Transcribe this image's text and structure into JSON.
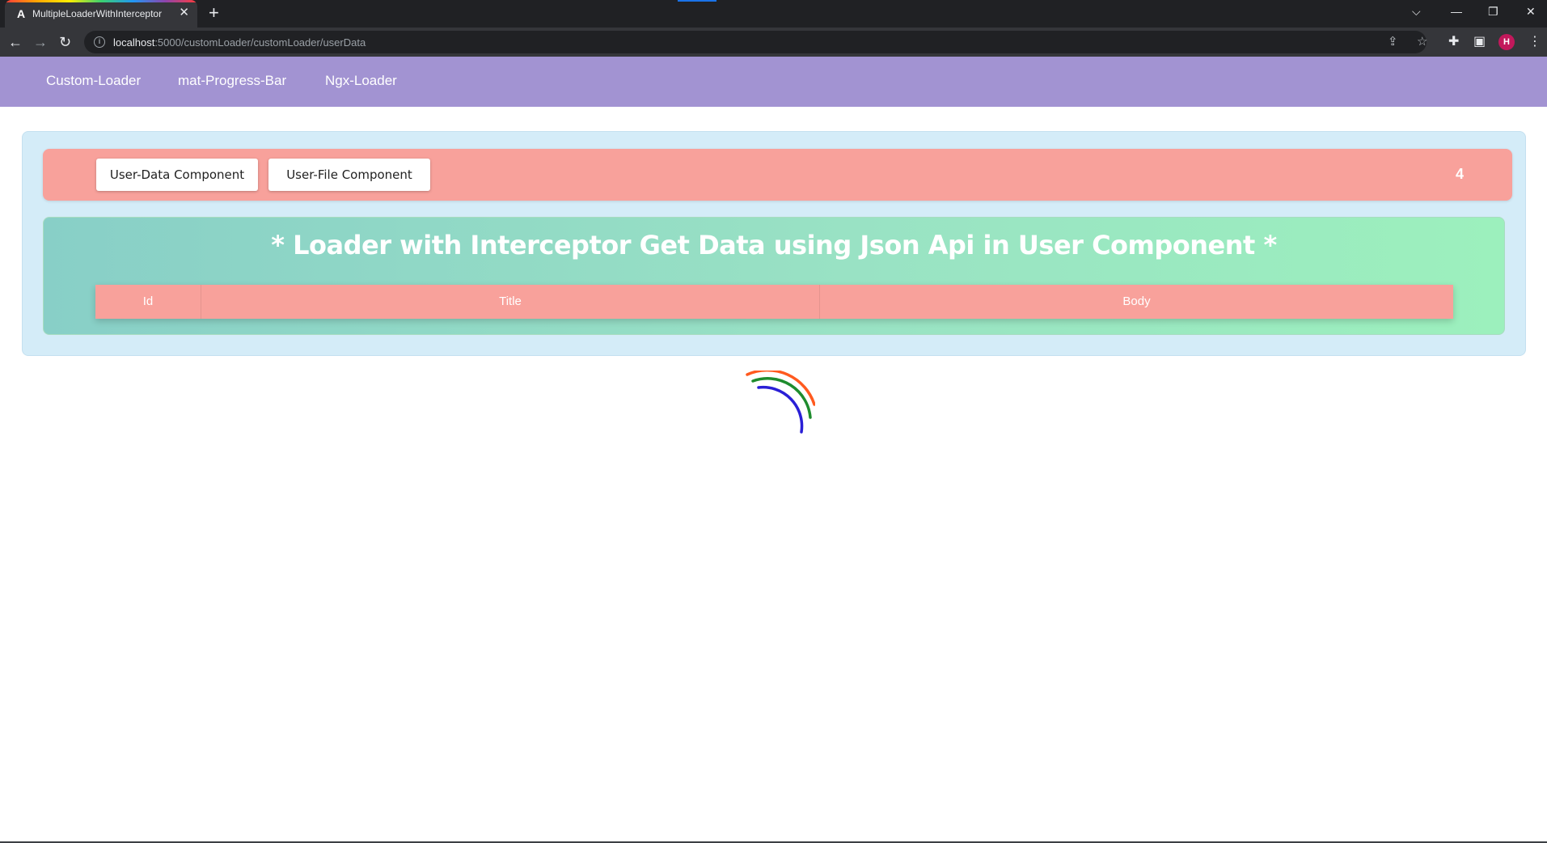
{
  "browser": {
    "tab_title": "MultipleLoaderWithInterceptor",
    "tab_favicon": "A",
    "new_tab_label": "+",
    "url_host": "localhost",
    "url_rest": ":5000/customLoader/customLoader/userData",
    "profile_initial": "H",
    "icons": {
      "back": "arrow-left-icon",
      "forward": "arrow-right-icon",
      "reload": "reload-icon",
      "site_info": "info-icon",
      "share": "share-icon",
      "bookmark": "star-icon",
      "extensions": "puzzle-icon",
      "side_panel": "side-panel-icon",
      "menu": "kebab-menu-icon"
    }
  },
  "nav": {
    "links": [
      "Custom-Loader",
      "mat-Progress-Bar",
      "Ngx-Loader"
    ],
    "background": "#a293d2"
  },
  "toolbar": {
    "user_data_button": "User-Data Component",
    "user_file_button": "User-File Component",
    "counter": "4",
    "background": "#f8a19b"
  },
  "main": {
    "heading": "* Loader with Interceptor Get Data using Json Api in User Component *",
    "table": {
      "columns": [
        "Id",
        "Title",
        "Body"
      ],
      "rows": []
    }
  },
  "loader": {
    "colors": [
      "#ff5a1f",
      "#1e8c2e",
      "#2a1fd6"
    ]
  }
}
